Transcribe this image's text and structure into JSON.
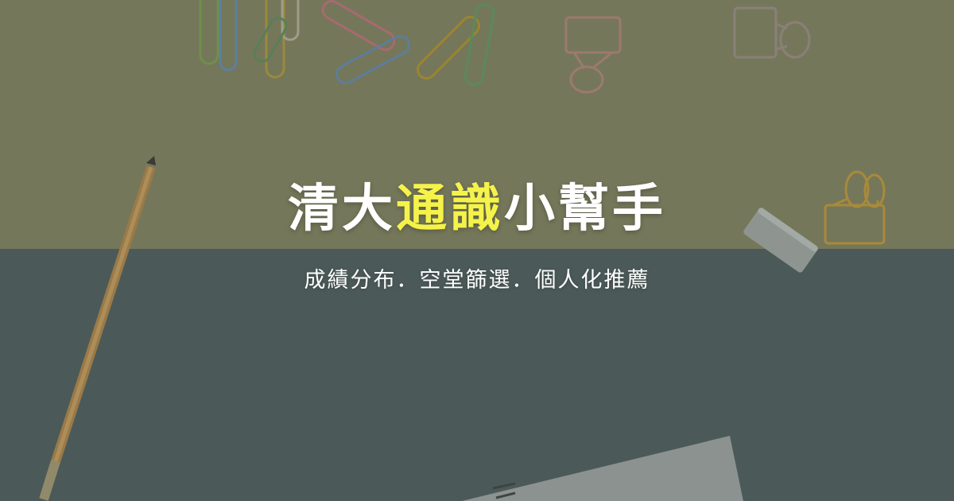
{
  "hero": {
    "title_part1": "清大",
    "title_highlight": "通識",
    "title_part2": "小幫手",
    "subtitle": "成績分布．空堂篩選．個人化推薦"
  },
  "colors": {
    "highlight": "#f5f34a",
    "text": "#ffffff",
    "top_background": "#75775a",
    "bottom_background": "#4b5a58"
  },
  "background_objects": [
    "paper-clip-icon",
    "binder-clip-icon",
    "pencil-icon",
    "eraser-icon",
    "notepad-icon"
  ]
}
